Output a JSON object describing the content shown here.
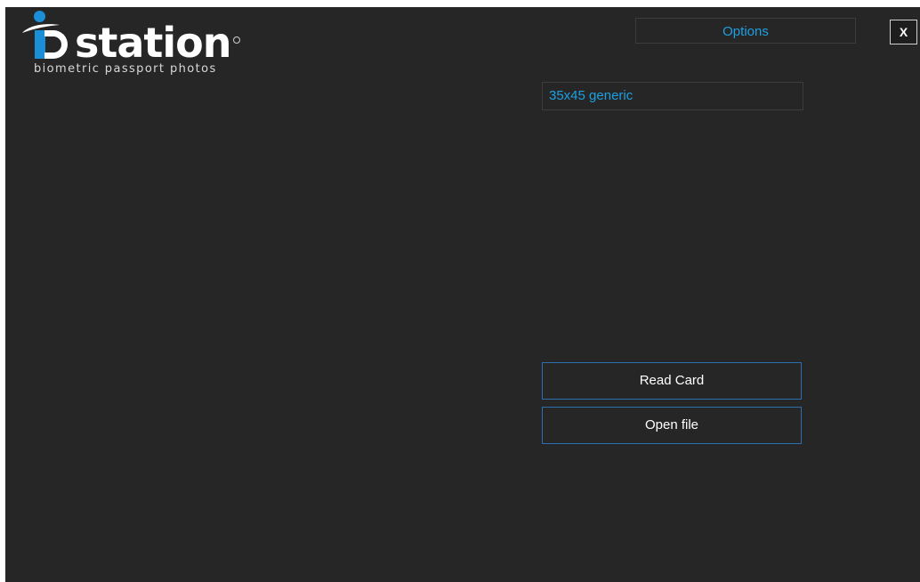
{
  "logo": {
    "wordmark": "station",
    "tagline": "biometric passport photos"
  },
  "header": {
    "options_label": "Options",
    "close_label": "X"
  },
  "format": {
    "selected": "35x45 generic"
  },
  "actions": {
    "read_card_label": "Read Card",
    "open_file_label": "Open file"
  },
  "colors": {
    "background": "#262626",
    "accent_blue": "#1ba1e2",
    "button_border": "#2b6fb0",
    "logo_blue": "#1a8fd8"
  }
}
